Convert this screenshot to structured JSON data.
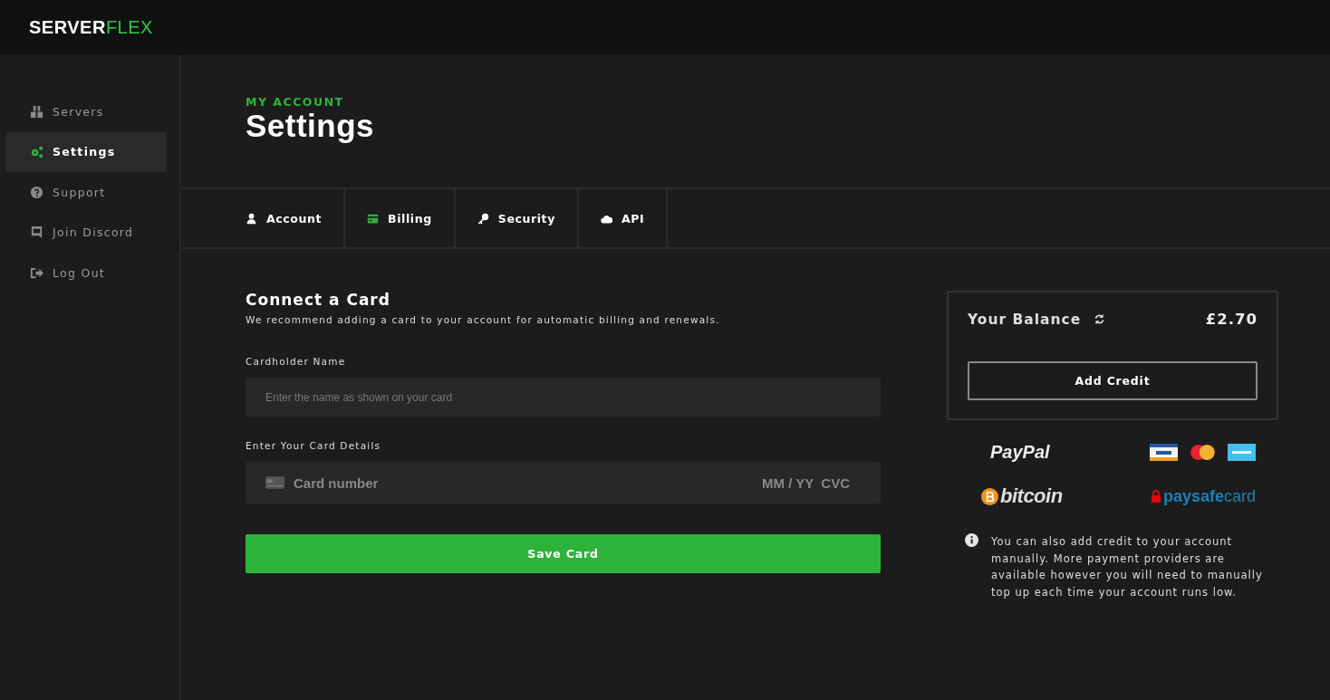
{
  "logo": {
    "part_1": "SERVER",
    "part_2": "FLEX"
  },
  "sidebar": {
    "items": [
      {
        "label": "Servers",
        "kind": "boxes",
        "selected": false
      },
      {
        "label": "Settings",
        "kind": "gears",
        "selected": true
      },
      {
        "label": "Support",
        "kind": "question",
        "selected": false
      },
      {
        "label": "Join Discord",
        "kind": "chat",
        "selected": false
      },
      {
        "label": "Log Out",
        "kind": "logout",
        "selected": false
      }
    ]
  },
  "page": {
    "eyebrow": "MY ACCOUNT",
    "title": "Settings"
  },
  "tabs": [
    {
      "label": "Account",
      "kind": "user",
      "selected": false
    },
    {
      "label": "Billing",
      "kind": "card",
      "selected": true
    },
    {
      "label": "Security",
      "kind": "key",
      "selected": false
    },
    {
      "label": "API",
      "kind": "cloud",
      "selected": false
    }
  ],
  "card_form": {
    "title": "Connect a Card",
    "subtitle": "We recommend adding a card to your account for automatic billing and renewals.",
    "name_label": "Cardholder Name",
    "name_placeholder": "Enter the name as shown on your card",
    "details_label": "Enter Your Card Details",
    "number_placeholder": "Card number",
    "expiry_placeholder": "MM / YY",
    "cvc_placeholder": "CVC",
    "save_button": "Save Card"
  },
  "balance": {
    "label": "Your Balance",
    "amount": "£2.70",
    "button": "Add Credit"
  },
  "providers": {
    "paypal": "PayPal",
    "bitcoin": "bitcoin",
    "paysafe_1": "paysafe",
    "paysafe_2": "card"
  },
  "info": "You can also add credit to your account manually. More payment providers are available however you will need to manually top up each time your account runs low."
}
